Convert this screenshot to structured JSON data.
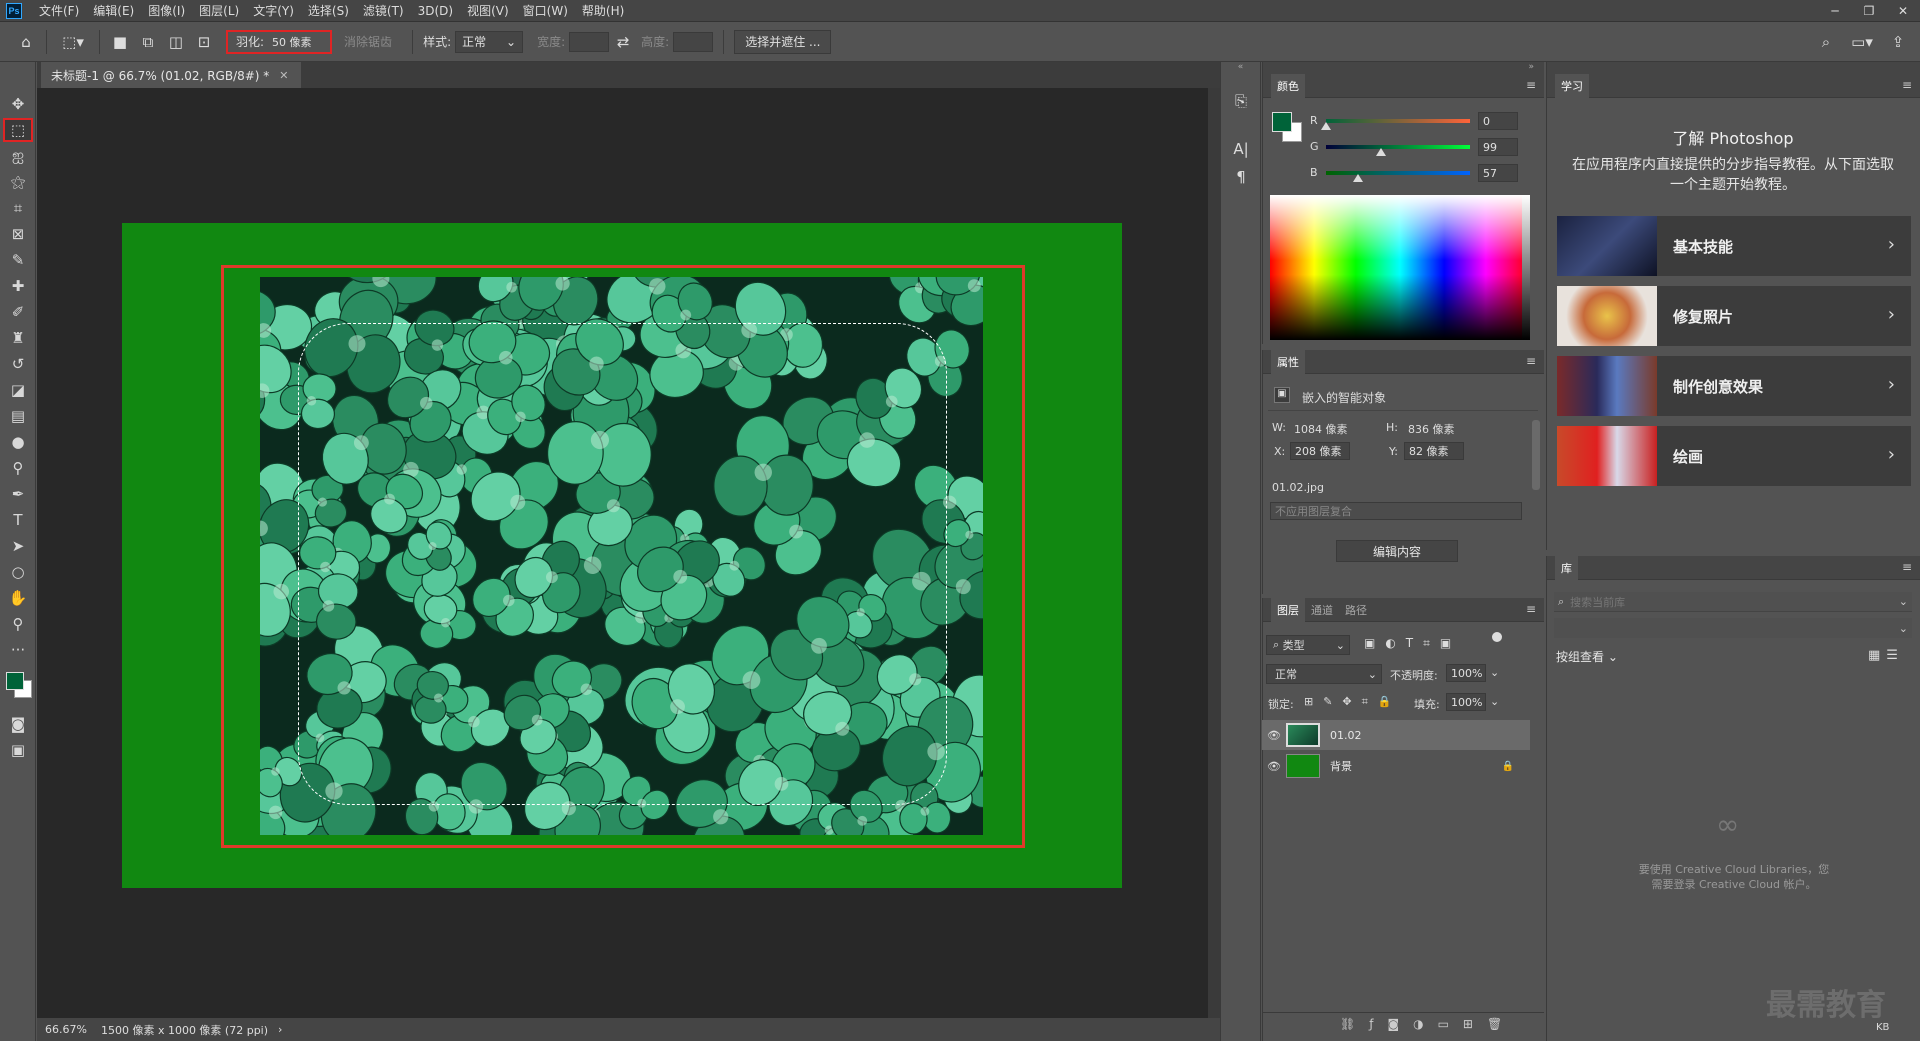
{
  "app": {
    "logo": "Ps",
    "menu": [
      "文件(F)",
      "编辑(E)",
      "图像(I)",
      "图层(L)",
      "文字(Y)",
      "选择(S)",
      "滤镜(T)",
      "3D(D)",
      "视图(V)",
      "窗口(W)",
      "帮助(H)"
    ]
  },
  "options": {
    "feather_label": "羽化:",
    "feather_value": "50 像素",
    "antialias_label": "消除锯齿",
    "style_label": "样式:",
    "style_value": "正常",
    "width_label": "宽度:",
    "height_label": "高度:",
    "select_mask_button": "选择并遮住 ..."
  },
  "document": {
    "tab_title": "未标题-1 @ 66.7% (01.02, RGB/8#) *",
    "zoom": "66.67%",
    "size_info": "1500 像素 x 1000 像素 (72 ppi)"
  },
  "color_panel": {
    "title": "颜色",
    "r_label": "R",
    "r_value": "0",
    "g_label": "G",
    "g_value": "99",
    "b_label": "B",
    "b_value": "57",
    "foreground": "#006339"
  },
  "properties_panel": {
    "title": "属性",
    "object_type": "嵌入的智能对象",
    "w_label": "W:",
    "w_value": "1084 像素",
    "h_label": "H:",
    "h_value": "836 像素",
    "x_label": "X:",
    "x_value": "208 像素",
    "y_label": "Y:",
    "y_value": "82 像素",
    "filename": "01.02.jpg",
    "layer_comp_placeholder": "不应用图层复合",
    "edit_contents_button": "编辑内容"
  },
  "layers_panel": {
    "tabs": [
      "图层",
      "通道",
      "路径"
    ],
    "filter_kind": "类型",
    "blend_mode": "正常",
    "opacity_label": "不透明度:",
    "opacity_value": "100%",
    "lock_label": "锁定:",
    "fill_label": "填充:",
    "fill_value": "100%",
    "layers": [
      {
        "name": "01.02",
        "selected": true
      },
      {
        "name": "背景",
        "selected": false
      }
    ]
  },
  "learn_panel": {
    "tab": "学习",
    "heading": "了解 Photoshop",
    "description": "在应用程序内直接提供的分步指导教程。从下面选取一个主题开始教程。",
    "cards": [
      "基本技能",
      "修复照片",
      "制作创意效果",
      "绘画"
    ]
  },
  "library_panel": {
    "tab": "库",
    "search_placeholder": "搜索当前库",
    "group_by": "按组查看",
    "message_line1": "要使用 Creative Cloud Libraries，您",
    "message_line2": "需要登录 Creative Cloud 帐户。"
  },
  "watermark": "最需教育",
  "kb_label": "KB"
}
